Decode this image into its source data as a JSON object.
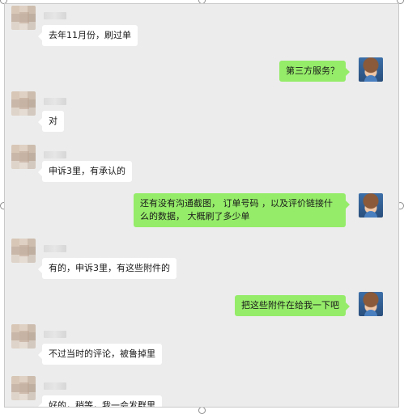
{
  "chat": {
    "messages": [
      {
        "sender": "other",
        "text": "去年11月份，刷过单"
      },
      {
        "sender": "me",
        "text": "第三方服务？"
      },
      {
        "sender": "other",
        "text": "对"
      },
      {
        "sender": "other",
        "text": "申诉3里，有承认的"
      },
      {
        "sender": "me",
        "text": "还有没有沟通截图， 订单号码 ，以及评价链接什么的数据， 大概刷了多少单"
      },
      {
        "sender": "other",
        "text": "有的，申诉3里，有这些附件的"
      },
      {
        "sender": "me",
        "text": "把这些附件在给我一下吧"
      },
      {
        "sender": "other",
        "text": "不过当时的评论，被鲁掉里"
      },
      {
        "sender": "other",
        "text": "好的，稍等，我一会发群里"
      }
    ]
  },
  "colors": {
    "background": "#ececec",
    "my_bubble": "#95ec69",
    "their_bubble": "#ffffff"
  }
}
